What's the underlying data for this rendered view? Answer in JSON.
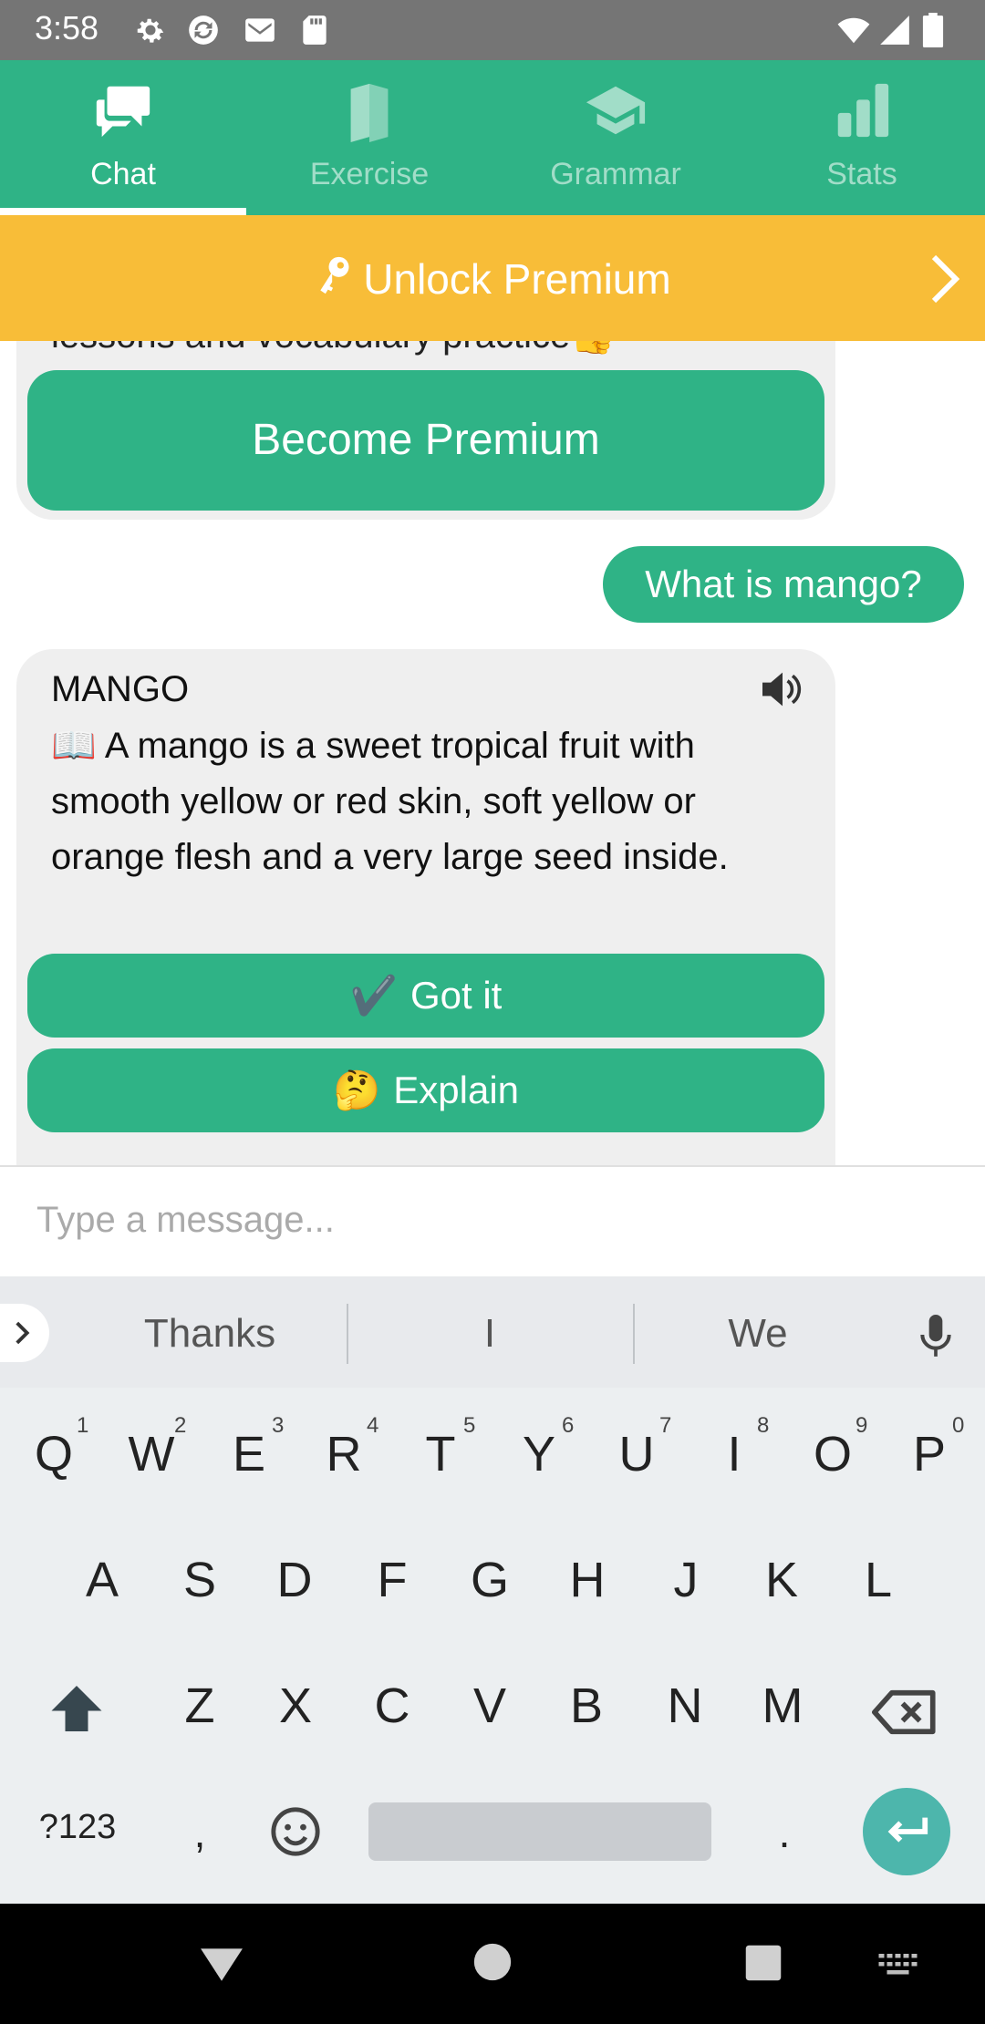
{
  "status_bar": {
    "time": "3:58",
    "icons": [
      "settings-icon",
      "sync-icon",
      "gmail-icon",
      "sd-card-icon",
      "wifi-icon",
      "signal-icon",
      "battery-icon"
    ]
  },
  "tabs": [
    {
      "label": "Chat",
      "icon": "chat-icon",
      "active": true
    },
    {
      "label": "Exercise",
      "icon": "book-icon",
      "active": false
    },
    {
      "label": "Grammar",
      "icon": "graduation-cap-icon",
      "active": false
    },
    {
      "label": "Stats",
      "icon": "bar-chart-icon",
      "active": false
    }
  ],
  "banner": {
    "text": "Unlock Premium"
  },
  "chat": {
    "cut_text": "lessons and vocabulary practice👍",
    "become_premium": "Become Premium",
    "user_message": "What is mango?",
    "bot_title": "MANGO",
    "bot_text": "A mango is a sweet tropical fruit with smooth yellow or red skin, soft yellow or orange flesh and a very large seed inside.",
    "book_emoji": "📖",
    "got_it_emoji": "✔️",
    "got_it": "Got it",
    "explain_emoji": "🤔",
    "explain": "Explain"
  },
  "input": {
    "placeholder": "Type a message..."
  },
  "keyboard": {
    "suggestions": [
      "Thanks",
      "I",
      "We"
    ],
    "row1": [
      "Q",
      "W",
      "E",
      "R",
      "T",
      "Y",
      "U",
      "I",
      "O",
      "P"
    ],
    "row1_nums": [
      "1",
      "2",
      "3",
      "4",
      "5",
      "6",
      "7",
      "8",
      "9",
      "0"
    ],
    "row2": [
      "A",
      "S",
      "D",
      "F",
      "G",
      "H",
      "J",
      "K",
      "L"
    ],
    "row3": [
      "Z",
      "X",
      "C",
      "V",
      "B",
      "N",
      "M"
    ],
    "symbols_key": "?123",
    "comma": ",",
    "period": "."
  },
  "colors": {
    "primary": "#2fb386",
    "banner": "#f8bd38",
    "bubble": "#efefef",
    "enter": "#4db6ac"
  }
}
